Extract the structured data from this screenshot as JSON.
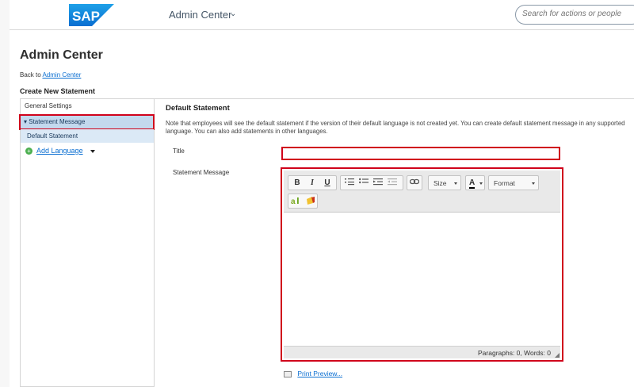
{
  "header": {
    "logo_text": "SAP",
    "module_title": "Admin Center",
    "search_placeholder": "Search for actions or people",
    "brand_color": "#0a6ed1"
  },
  "page": {
    "title": "Admin Center",
    "back_prefix": "Back to",
    "back_link": "Admin Center",
    "section_title": "Create New Statement"
  },
  "leftnav": {
    "general_settings": "General Settings",
    "statement_message": "Statement Message",
    "default_statement": "Default Statement",
    "add_language": "Add Language"
  },
  "content": {
    "heading": "Default Statement",
    "note": "Note that employees will see the default statement if the version of their default language is not created yet. You can create default statement message in any supported language. You can also add statements in other languages.",
    "title_label": "Title",
    "title_value": "",
    "statement_label": "Statement Message",
    "editor": {
      "toolbar": {
        "bold": "B",
        "italic": "I",
        "underline": "U",
        "size": "Size",
        "font_color": "A",
        "format": "Format"
      },
      "status": "Paragraphs: 0, Words: 0"
    },
    "print_preview": "Print Preview..."
  },
  "colors": {
    "highlight": "#d0021b",
    "nav_selected": "#c3d9ee",
    "nav_child": "#dbe9f6"
  }
}
